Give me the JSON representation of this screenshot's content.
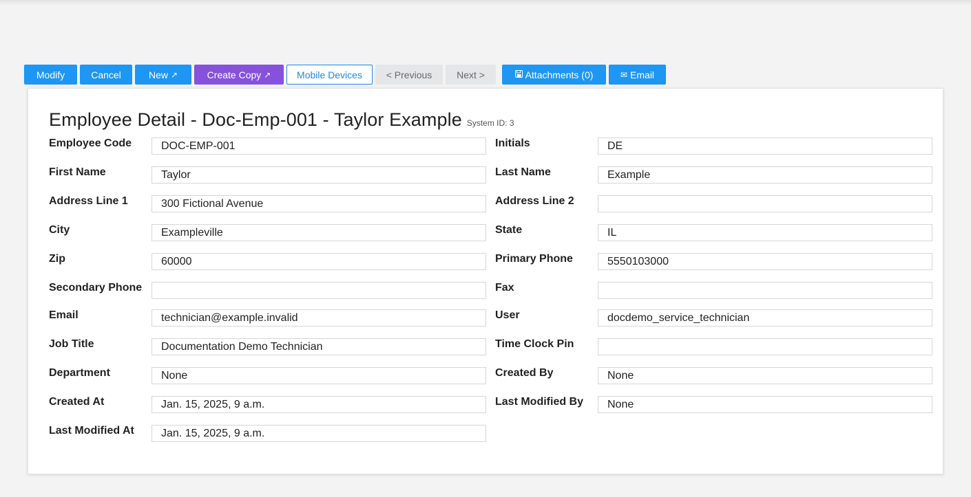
{
  "toolbar": {
    "modify": "Modify",
    "cancel": "Cancel",
    "new": "New",
    "new_icon": "external-link-icon",
    "create_copy": "Create Copy",
    "create_copy_icon": "external-link-icon",
    "mobile_devices": "Mobile Devices",
    "previous": "< Previous",
    "next": "Next >",
    "attachments": "Attachments (0)",
    "attachments_icon": "floppy-disk-icon",
    "email": "Email",
    "email_icon": "envelope-icon"
  },
  "header": {
    "title": "Employee Detail - Doc-Emp-001 - Taylor Example",
    "system_id": "System ID: 3"
  },
  "fields": {
    "employee_code": {
      "label": "Employee Code",
      "value": "DOC-EMP-001"
    },
    "initials": {
      "label": "Initials",
      "value": "DE"
    },
    "first_name": {
      "label": "First Name",
      "value": "Taylor"
    },
    "last_name": {
      "label": "Last Name",
      "value": "Example"
    },
    "address_line_1": {
      "label": "Address Line 1",
      "value": "300 Fictional Avenue"
    },
    "address_line_2": {
      "label": "Address Line 2",
      "value": ""
    },
    "city": {
      "label": "City",
      "value": "Exampleville"
    },
    "state": {
      "label": "State",
      "value": "IL"
    },
    "zip": {
      "label": "Zip",
      "value": "60000"
    },
    "primary_phone": {
      "label": "Primary Phone",
      "value": "5550103000"
    },
    "secondary_phone": {
      "label": "Secondary Phone",
      "value": ""
    },
    "fax": {
      "label": "Fax",
      "value": ""
    },
    "email": {
      "label": "Email",
      "value": "technician@example.invalid"
    },
    "user": {
      "label": "User",
      "value": "docdemo_service_technician"
    },
    "job_title": {
      "label": "Job Title",
      "value": "Documentation Demo Technician"
    },
    "time_clock_pin": {
      "label": "Time Clock Pin",
      "value": ""
    },
    "department": {
      "label": "Department",
      "value": "None"
    },
    "created_by": {
      "label": "Created By",
      "value": "None"
    },
    "created_at": {
      "label": "Created At",
      "value": "Jan. 15, 2025, 9 a.m."
    },
    "last_modified_by": {
      "label": "Last Modified By",
      "value": "None"
    },
    "last_modified_at": {
      "label": "Last Modified At",
      "value": "Jan. 15, 2025, 9 a.m."
    }
  },
  "colors": {
    "primary": "#1e96f3",
    "purple": "#8652dc",
    "disabled_bg": "#e4e6e8",
    "background": "#f3f3f4"
  }
}
